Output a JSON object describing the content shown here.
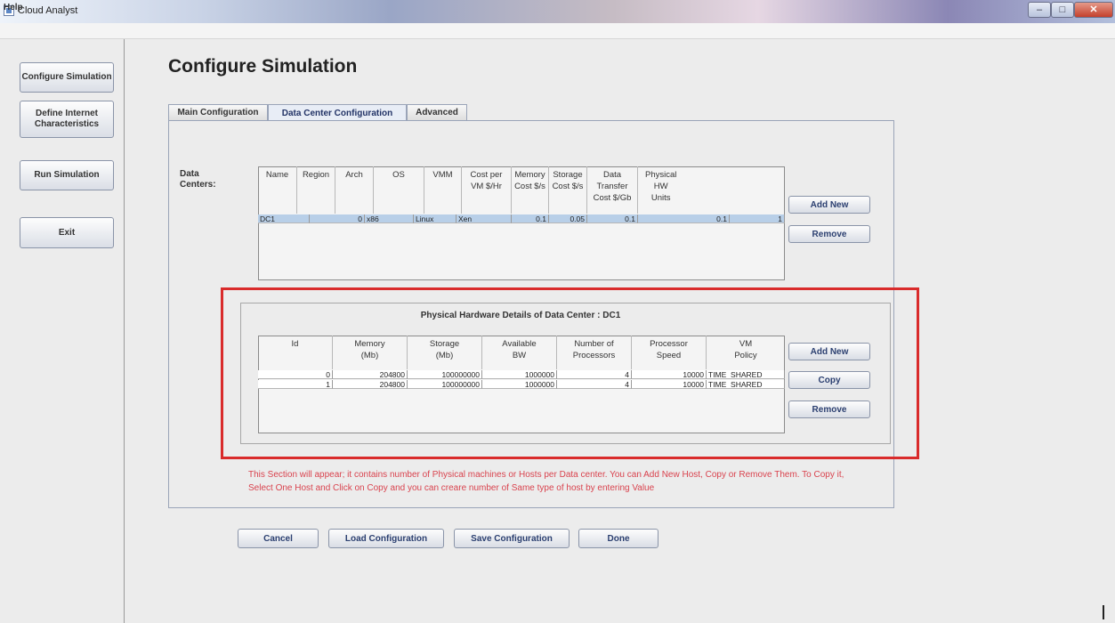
{
  "window": {
    "title": "Cloud Analyst",
    "menu": [
      "Help"
    ],
    "controls": [
      "–",
      "□",
      "✕"
    ]
  },
  "nav": {
    "items": [
      {
        "id": "configure",
        "label": "Configure Simulation"
      },
      {
        "id": "internet",
        "label": "Define Internet Characteristics"
      },
      {
        "id": "run",
        "label": "Run Simulation"
      },
      {
        "id": "exit",
        "label": "Exit"
      }
    ]
  },
  "page": {
    "title": "Configure Simulation",
    "tabs": [
      "Main Configuration",
      "Data Center Configuration",
      "Advanced"
    ],
    "active_tab": "Data Center Configuration"
  },
  "datacenters": {
    "label": "Data\nCenters:",
    "columns": [
      "Name",
      "Region",
      "Arch",
      "OS",
      "VMM",
      "Cost per\nVM $/Hr",
      "Memory\nCost $/s",
      "Storage\nCost $/s",
      "Data\nTransfer\nCost $/Gb",
      "Physical\nHW\nUnits"
    ],
    "rows": [
      [
        "DC1",
        "0",
        "x86",
        "Linux",
        "Xen",
        "0.1",
        "0.05",
        "0.1",
        "0.1",
        "1"
      ]
    ],
    "buttons": {
      "add": "Add New",
      "remove": "Remove"
    }
  },
  "hardware": {
    "title": "Physical Hardware Details of Data Center : DC1",
    "columns": [
      "Id",
      "Memory\n(Mb)",
      "Storage\n(Mb)",
      "Available\nBW",
      "Number of\nProcessors",
      "Processor\nSpeed",
      "VM\nPolicy"
    ],
    "rows": [
      [
        "0",
        "204800",
        "100000000",
        "1000000",
        "4",
        "10000",
        "TIME_SHARED"
      ],
      [
        "1",
        "204800",
        "100000000",
        "1000000",
        "4",
        "10000",
        "TIME_SHARED"
      ]
    ],
    "buttons": {
      "add": "Add New",
      "copy": "Copy",
      "remove": "Remove"
    }
  },
  "annotation": "This Section will appear; it contains number of Physical machines or Hosts per Data center. You can Add New Host, Copy or Remove Them. To Copy it, Select One Host and Click on Copy and you can creare number of Same type of host by entering Value",
  "footer_buttons": {
    "cancel": "Cancel",
    "load": "Load Configuration",
    "save": "Save Configuration",
    "done": "Done"
  },
  "colors": {
    "highlight_box": "#d92b2b",
    "annotation_text": "#d9434e",
    "selected_row": "#b8cfe8"
  }
}
